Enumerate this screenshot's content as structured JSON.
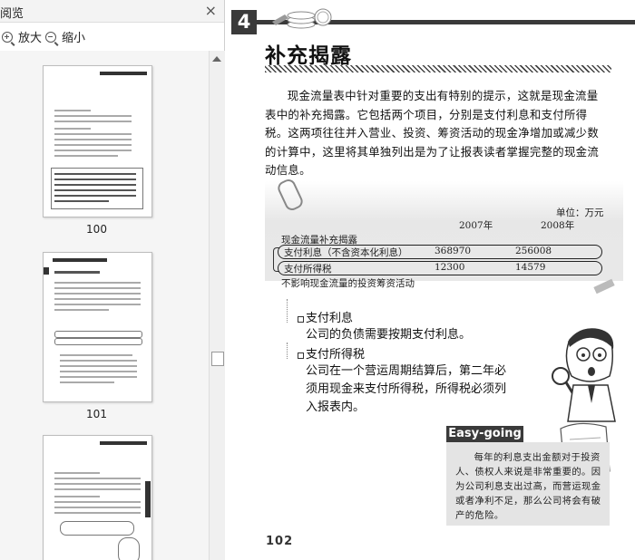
{
  "pane": {
    "title": "阅览",
    "close_glyph": "×",
    "zoom_in_label": "放大",
    "zoom_out_label": "缩小",
    "thumbnails": [
      {
        "label": "100"
      },
      {
        "label": "101"
      }
    ]
  },
  "page": {
    "chapter_number": "4",
    "heading": "补充揭露",
    "paragraph": "现金流量表中针对重要的支出有特别的提示，这就是现金流量表中的补充揭露。它包括两个项目，分别是支付利息和支付所得税。这两项往往并入营业、投资、筹资活动的现金净增加或减少数的计算中，这里将其单独列出是为了让报表读者掌握完整的现金流动信息。",
    "table": {
      "unit": "单位：万元",
      "years": [
        "2007年",
        "2008年"
      ],
      "title": "现金流量补充揭露",
      "rows": [
        {
          "label": "支付利息（不含资本化利息）",
          "v2007": "368970",
          "v2008": "256008"
        },
        {
          "label": "支付所得税",
          "v2007": "12300",
          "v2008": "14579"
        }
      ],
      "note": "不影响现金流量的投资筹资活动"
    },
    "bullets": [
      {
        "title": "支付利息",
        "text": "公司的负债需要按期支付利息。"
      },
      {
        "title": "支付所得税",
        "text": "公司在一个营运周期结算后，第二年必须用现金来支付所得税，所得税必须列入报表内。"
      }
    ],
    "easy_going": {
      "label": "Easy-going",
      "text": "每年的利息支出金额对于投资人、债权人来说是非常重要的。因为公司利息支出过高，而营运现金或者净利不足，那么公司将会有破产的危险。"
    },
    "page_number": "102"
  }
}
